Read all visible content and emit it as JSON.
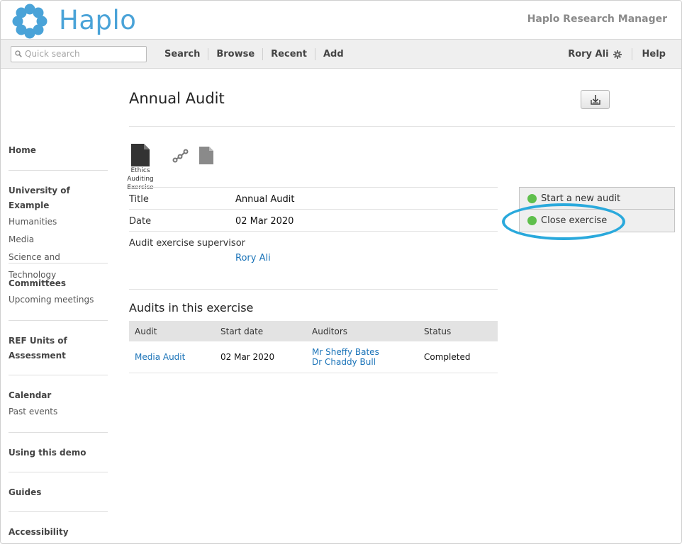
{
  "header": {
    "logo_text": "Haplo",
    "app_name": "Haplo Research Manager",
    "brand_color": "#4aa3d8"
  },
  "navbar": {
    "search_placeholder": "Quick search",
    "links": [
      "Search",
      "Browse",
      "Recent",
      "Add"
    ],
    "user": "Rory Ali",
    "help": "Help"
  },
  "sidebar": {
    "groups": [
      {
        "head": "Home",
        "items": []
      },
      {
        "head": "University of Example",
        "items": [
          "Humanities",
          "Media",
          "Science and Technology"
        ]
      },
      {
        "head": "Committees",
        "items": [
          "Upcoming meetings"
        ]
      },
      {
        "head": "REF Units of Assessment",
        "items": []
      },
      {
        "head": "Calendar",
        "items": [
          "Past events"
        ]
      },
      {
        "head": "Using this demo",
        "items": []
      },
      {
        "head": "Guides",
        "items": []
      },
      {
        "head": "Accessibility",
        "items": []
      }
    ]
  },
  "main": {
    "title": "Annual Audit",
    "doc_type_label": "Ethics Auditing Exercise",
    "fields": [
      {
        "label": "Title",
        "value": "Annual Audit"
      },
      {
        "label": "Date",
        "value": "02 Mar 2020"
      },
      {
        "label": "Audit exercise supervisor",
        "value": "Rory Ali"
      }
    ],
    "actions": [
      "Start a new audit",
      "Close exercise"
    ],
    "audits_title": "Audits in this exercise",
    "table": {
      "headers": [
        "Audit",
        "Start date",
        "Auditors",
        "Status"
      ],
      "rows": [
        {
          "audit": "Media Audit",
          "start": "02 Mar 2020",
          "auditors": [
            "Mr Sheffy Bates",
            "Dr Chaddy Bull"
          ],
          "status": "Completed"
        }
      ]
    }
  }
}
